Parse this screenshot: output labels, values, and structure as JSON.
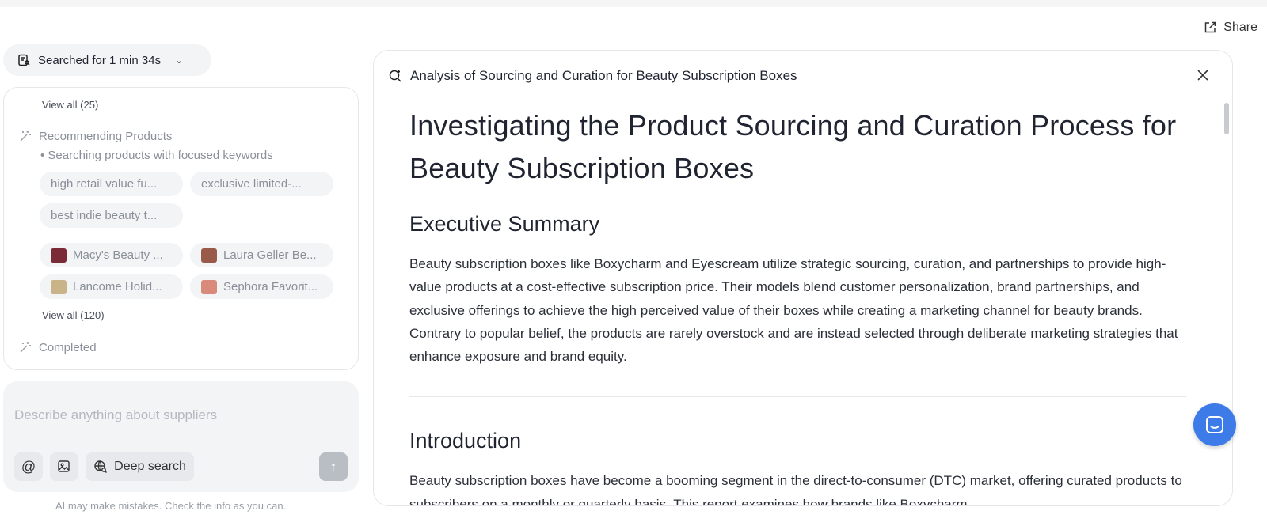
{
  "header": {
    "share_label": "Share"
  },
  "left": {
    "searched_label": "Searched for 1 min 34s",
    "view_all_top": "View all (25)",
    "step_recommending": "Recommending Products",
    "bullet_text": "Searching products with focused keywords",
    "keywords": [
      "high retail value fu...",
      "exclusive limited-...",
      "best indie beauty t..."
    ],
    "products": [
      {
        "label": "Macy's Beauty ...",
        "thumb_color": "#7a2b36"
      },
      {
        "label": "Laura Geller Be...",
        "thumb_color": "#9a5a4a"
      },
      {
        "label": "Lancome Holid...",
        "thumb_color": "#c9b48a"
      },
      {
        "label": "Sephora Favorit...",
        "thumb_color": "#d98a7a"
      }
    ],
    "view_all_bottom": "View all (120)",
    "step_completed": "Completed",
    "input_placeholder": "Describe anything about suppliers",
    "deep_search_label": "Deep search",
    "at_label": "@",
    "disclaimer": "AI may make mistakes. Check the info as you can."
  },
  "report": {
    "header_title": "Analysis of Sourcing and Curation for Beauty Subscription Boxes",
    "title": "Investigating the Product Sourcing and Curation Process for Beauty Subscription Boxes",
    "section1_title": "Executive Summary",
    "section1_body": "Beauty subscription boxes like Boxycharm and Eyescream utilize strategic sourcing, curation, and partnerships to provide high-value products at a cost-effective subscription price. Their models blend customer personalization, brand partnerships, and exclusive offerings to achieve the high perceived value of their boxes while creating a marketing channel for beauty brands. Contrary to popular belief, the products are rarely overstock and are instead selected through deliberate marketing strategies that enhance exposure and brand equity.",
    "section2_title": "Introduction",
    "section2_body": "Beauty subscription boxes have become a booming segment in the direct-to-consumer (DTC) market, offering curated products to subscribers on a monthly or quarterly basis. This report examines how brands like Boxycharm"
  },
  "colors": {
    "accent": "#3d7be8",
    "muted": "#8a8f99",
    "chip_bg": "#f3f4f6"
  }
}
